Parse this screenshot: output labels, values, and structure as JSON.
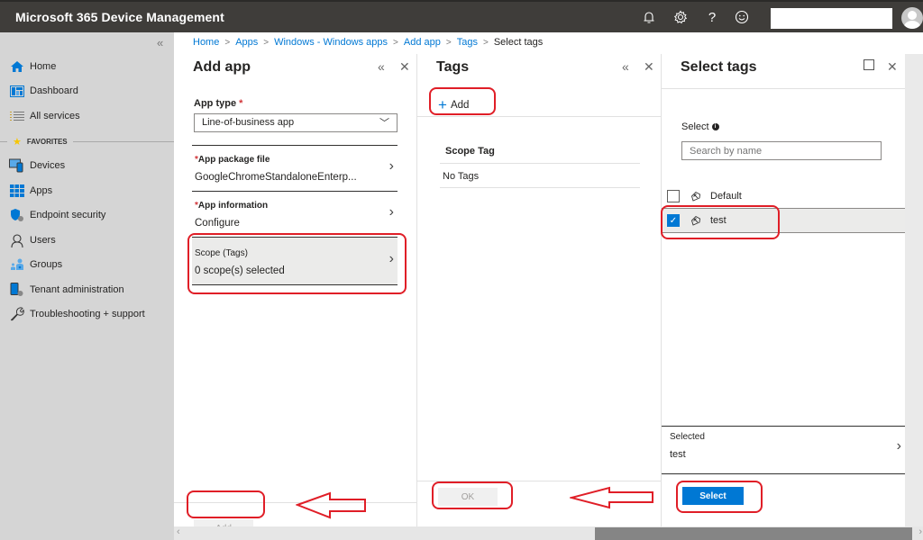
{
  "app": {
    "title": "Microsoft 365 Device Management",
    "topbar_icons": [
      "bell-icon",
      "gear-icon",
      "help-icon",
      "feedback-smiley-icon"
    ],
    "icon_glyphs": {
      "bell": "🔔",
      "gear": "⚙",
      "help": "?",
      "smiley": "☺"
    }
  },
  "sidebar": {
    "collapse_glyph": "«",
    "items": [
      {
        "label": "Home",
        "icon": "home-icon"
      },
      {
        "label": "Dashboard",
        "icon": "dashboard-icon"
      },
      {
        "label": "All services",
        "icon": "list-icon"
      }
    ],
    "favorites_label": "FAVORITES",
    "favorites": [
      {
        "label": "Devices",
        "icon": "devices-icon"
      },
      {
        "label": "Apps",
        "icon": "apps-grid-icon"
      },
      {
        "label": "Endpoint security",
        "icon": "shield-icon"
      },
      {
        "label": "Users",
        "icon": "user-icon"
      },
      {
        "label": "Groups",
        "icon": "groups-icon"
      },
      {
        "label": "Tenant administration",
        "icon": "tenant-admin-icon"
      },
      {
        "label": "Troubleshooting + support",
        "icon": "wrench-icon"
      }
    ]
  },
  "breadcrumb": [
    "Home",
    "Apps",
    "Windows - Windows apps",
    "Add app",
    "Tags",
    "Select tags"
  ],
  "breadcrumb_sep": ">",
  "add_app_blade": {
    "title": "Add app",
    "app_type_label": "App type",
    "required_mark": "*",
    "app_type_value": "Line-of-business app",
    "rows": [
      {
        "label": "App package file",
        "value": "GoogleChromeStandaloneEnterp...",
        "required": true
      },
      {
        "label": "App information",
        "value": "Configure",
        "required": true
      },
      {
        "label": "Scope (Tags)",
        "value": "0 scope(s) selected",
        "required": false
      }
    ],
    "add_button": "Add"
  },
  "tags_blade": {
    "title": "Tags",
    "add_command": "Add",
    "table_header": "Scope Tag",
    "table_rows": [
      "No Tags"
    ],
    "ok_button": "OK"
  },
  "select_tags_blade": {
    "title": "Select tags",
    "select_label": "Select",
    "info_glyph": "i",
    "search_placeholder": "Search by name",
    "tags": [
      {
        "name": "Default",
        "checked": false
      },
      {
        "name": "test",
        "checked": true
      }
    ],
    "selected_label": "Selected",
    "selected_value": "test",
    "select_button": "Select"
  },
  "colors": {
    "accent": "#0078d4",
    "topbar": "#3f3d3a",
    "sidebar": "#d5d5d5",
    "annotation": "#e01e27"
  }
}
